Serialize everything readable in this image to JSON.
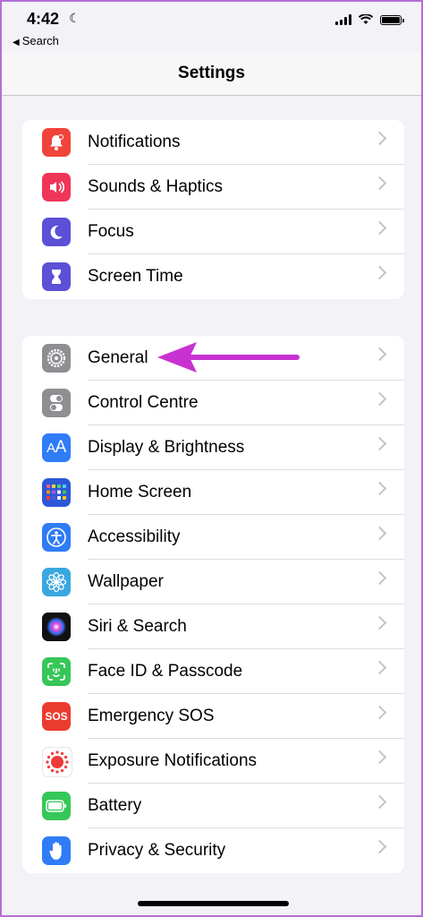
{
  "status": {
    "time": "4:42",
    "back_label": "Search"
  },
  "nav": {
    "title": "Settings"
  },
  "group1": [
    {
      "label": "Notifications",
      "icon": "bell-icon",
      "color": "#f0443a"
    },
    {
      "label": "Sounds & Haptics",
      "icon": "speaker-icon",
      "color": "#f0355a"
    },
    {
      "label": "Focus",
      "icon": "moon-icon",
      "color": "#5b50d6"
    },
    {
      "label": "Screen Time",
      "icon": "hourglass-icon",
      "color": "#5b50d6"
    }
  ],
  "group2": [
    {
      "label": "General",
      "icon": "gear-icon",
      "color": "#8e8e93"
    },
    {
      "label": "Control Centre",
      "icon": "toggles-icon",
      "color": "#8e8e93"
    },
    {
      "label": "Display & Brightness",
      "icon": "text-size-icon",
      "color": "#2f7cf6"
    },
    {
      "label": "Home Screen",
      "icon": "app-grid-icon",
      "color": "#2e57d8"
    },
    {
      "label": "Accessibility",
      "icon": "accessibility-icon",
      "color": "#2f7cf6"
    },
    {
      "label": "Wallpaper",
      "icon": "flower-icon",
      "color": "#3aa7e0"
    },
    {
      "label": "Siri & Search",
      "icon": "siri-icon",
      "color": "#222"
    },
    {
      "label": "Face ID & Passcode",
      "icon": "face-id-icon",
      "color": "#36c759"
    },
    {
      "label": "Emergency SOS",
      "icon": "sos-icon",
      "color": "#eb3b30",
      "text": "SOS"
    },
    {
      "label": "Exposure Notifications",
      "icon": "exposure-icon",
      "color": "#ffffff"
    },
    {
      "label": "Battery",
      "icon": "battery-icon",
      "color": "#36c759"
    },
    {
      "label": "Privacy & Security",
      "icon": "hand-icon",
      "color": "#2f7cf6"
    }
  ],
  "annotation_color": "#c832d2"
}
